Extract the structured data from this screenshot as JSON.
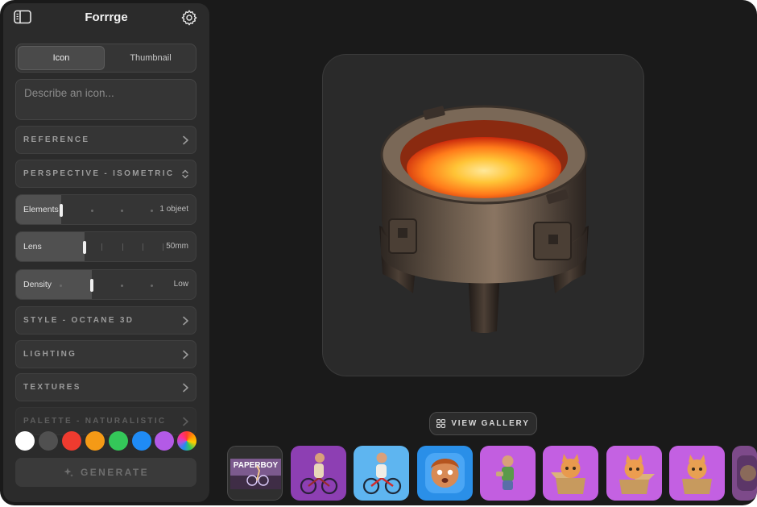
{
  "app": {
    "title": "Forrrge"
  },
  "icons": {
    "sidebar_toggle": "sidebar-toggle-icon",
    "settings": "gear-icon",
    "chevron": "chevron-right-icon",
    "select": "chevron-up-down-icon",
    "generate": "sparkle-icon",
    "gallery": "grid-icon"
  },
  "mode_tabs": [
    {
      "label": "Icon",
      "selected": true
    },
    {
      "label": "Thumbnail",
      "selected": false
    }
  ],
  "prompt": {
    "placeholder": "Describe an icon...",
    "value": ""
  },
  "sections": {
    "reference": "REFERENCE",
    "perspective": "PERSPECTIVE - ISOMETRIC",
    "style": "STYLE - OCTANE 3D",
    "lighting": "LIGHTING",
    "textures": "TEXTURES",
    "palette": "PALETTE - NATURALISTIC"
  },
  "sliders": {
    "elements": {
      "label": "Elements",
      "value": "1 objeet",
      "level": 0.0
    },
    "lens": {
      "label": "Lens",
      "value": "50mm",
      "level": 0.33
    },
    "density": {
      "label": "Density",
      "value": "Low",
      "level": 0.33
    }
  },
  "palette_colors": [
    "#ffffff",
    "#505050",
    "#ef3b2f",
    "#f59a16",
    "#34c759",
    "#1f8bf5",
    "#b35ae6",
    "conic"
  ],
  "generate": {
    "label": "GENERATE"
  },
  "gallery": {
    "label": "VIEW GALLERY"
  },
  "thumbnails": [
    {
      "caption": "PAPERBOY",
      "bg": "#3a3a3a"
    },
    {
      "caption": "",
      "bg": "#8d3fb3"
    },
    {
      "caption": "",
      "bg": "#5eb5f0"
    },
    {
      "caption": "",
      "bg": "#2a8fe8"
    },
    {
      "caption": "",
      "bg": "#c25ee0"
    },
    {
      "caption": "",
      "bg": "#c35fe2"
    },
    {
      "caption": "",
      "bg": "#c462e2"
    },
    {
      "caption": "",
      "bg": "#c360e2"
    },
    {
      "caption": "",
      "bg": "#7d4a8a"
    }
  ]
}
